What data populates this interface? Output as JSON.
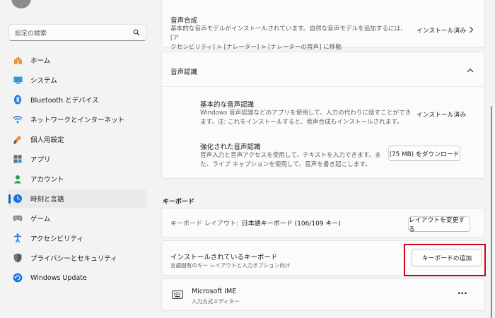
{
  "sidebar": {
    "search_placeholder": "設定の検索",
    "items": [
      {
        "label": "ホーム",
        "icon": "home-icon"
      },
      {
        "label": "システム",
        "icon": "system-icon"
      },
      {
        "label": "Bluetooth とデバイス",
        "icon": "bluetooth-icon"
      },
      {
        "label": "ネットワークとインターネット",
        "icon": "network-icon"
      },
      {
        "label": "個人用設定",
        "icon": "brush-icon"
      },
      {
        "label": "アプリ",
        "icon": "apps-icon"
      },
      {
        "label": "アカウント",
        "icon": "account-icon"
      },
      {
        "label": "時刻と言語",
        "icon": "time-language-icon",
        "selected": true
      },
      {
        "label": "ゲーム",
        "icon": "gaming-icon"
      },
      {
        "label": "アクセシビリティ",
        "icon": "accessibility-icon"
      },
      {
        "label": "プライバシーとセキュリティ",
        "icon": "shield-icon"
      },
      {
        "label": "Windows Update",
        "icon": "update-icon"
      }
    ]
  },
  "speech_synthesis": {
    "title": "音声合成",
    "desc1": "基本的な音声モデルがインストールされています。自然な音声モデルを追加するには、[ア",
    "desc2": "クセシビリティ] > [ナレーター] > [ナレーターの音声] に移動",
    "status": "インストール済み"
  },
  "speech_recognition": {
    "title": "音声認識",
    "basic": {
      "title": "基本的な音声認識",
      "desc1": "Windows 音声認識などのアプリを使用して、入力の代わりに話すことができ",
      "desc2": "ます。注: これをインストールすると、音声合成もインストールされます。",
      "status": "インストール済み"
    },
    "enhanced": {
      "title": "強化された音声認識",
      "desc1": "音声入力と音声アクセスを使用して、テキストを入力できます。ま",
      "desc2": "た、ライブ キャプションを使用して、音声を書き起こします。",
      "button": "(75 MB) をダウンロード"
    }
  },
  "keyboard": {
    "section_title": "キーボード",
    "layout_label": "キーボード レイアウト:",
    "layout_value": "日本語キーボード (106/109 キー)",
    "change_layout_button": "レイアウトを変更する",
    "installed_title": "インストールされているキーボード",
    "installed_desc": "言語固有のキー レイアウトと入力オプション向け",
    "add_keyboard_button": "キーボードの追加",
    "ime_name": "Microsoft IME",
    "ime_desc": "入力方式エディター",
    "more": "···"
  }
}
